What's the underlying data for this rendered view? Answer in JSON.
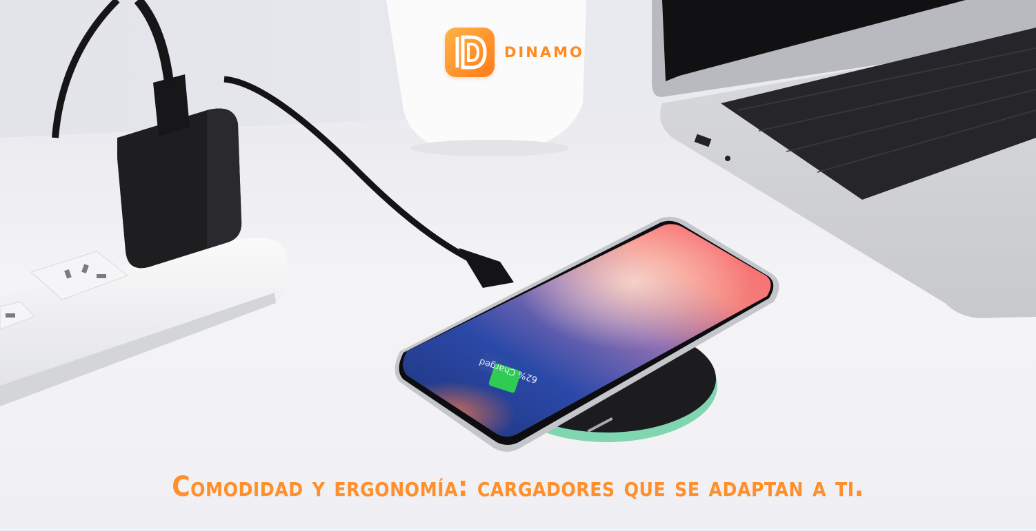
{
  "brand": {
    "name": "DINAMO",
    "logo_letter": "D"
  },
  "phone": {
    "charging_status": "62% Charged",
    "battery_level": 0.62
  },
  "caption": {
    "text": "Comodidad y ergonomía: cargadores que se adaptan a ti."
  },
  "colors": {
    "accent": "#ff8f2a",
    "logo_gradient_start": "#ffb347",
    "logo_gradient_end": "#ff7a18",
    "battery_fill": "#2ecc52",
    "pad_ring": "#7fd6b0",
    "pad_body": "#1c1c1e"
  }
}
